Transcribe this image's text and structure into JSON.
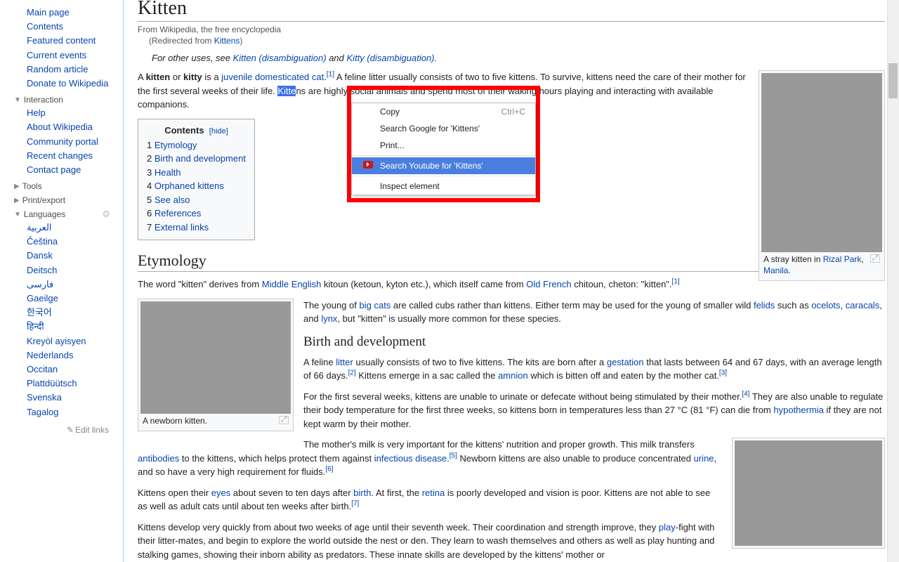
{
  "sidebar": {
    "main_nav": [
      "Main page",
      "Contents",
      "Featured content",
      "Current events",
      "Random article",
      "Donate to Wikipedia"
    ],
    "interaction_head": "Interaction",
    "interaction_items": [
      "Help",
      "About Wikipedia",
      "Community portal",
      "Recent changes",
      "Contact page"
    ],
    "tools_head": "Tools",
    "print_head": "Print/export",
    "languages_head": "Languages",
    "languages": [
      "العربية",
      "Čeština",
      "Dansk",
      "Deitsch",
      "فارسی",
      "Gaeilge",
      "한국어",
      "हिन्दी",
      "Kreyòl ayisyen",
      "Nederlands",
      "Occitan",
      "Plattdüütsch",
      "Svenska",
      "Tagalog"
    ],
    "edit_links": "Edit links"
  },
  "article": {
    "title": "Kitten",
    "from": "From Wikipedia, the free encyclopedia",
    "redir_prefix": "(Redirected from ",
    "redir_link": "Kittens",
    "redir_suffix": ")",
    "hatnote_pre": "For other uses, see ",
    "hatnote_l1": "Kitten (disambiguation)",
    "hatnote_mid": " and ",
    "hatnote_l2": "Kitty (disambiguation)",
    "intro_p": {
      "t1": "A ",
      "b1": "kitten",
      "t2": " or ",
      "b2": "kitty",
      "t3": " is a ",
      "l1": "juvenile",
      "l2": "domesticated cat",
      "ref1": "[1]",
      "t4": " A feline litter usually consists of two to five kittens. To survive, kittens need the care of their mother for the first several weeks of their life. ",
      "hl": "Kitte",
      "t5": "ns are highly social animals and spend most of their waking hours playing and interacting with available companions."
    },
    "toc_title": "Contents",
    "toc_hide": "[hide]",
    "toc": [
      {
        "n": "1",
        "t": "Etymology"
      },
      {
        "n": "2",
        "t": "Birth and development"
      },
      {
        "n": "3",
        "t": "Health"
      },
      {
        "n": "4",
        "t": "Orphaned kittens"
      },
      {
        "n": "5",
        "t": "See also"
      },
      {
        "n": "6",
        "t": "References"
      },
      {
        "n": "7",
        "t": "External links"
      }
    ],
    "thumb1_cap_pre": "A stray kitten in ",
    "thumb1_cap_l1": "Rizal Park",
    "thumb1_cap_mid": ", ",
    "thumb1_cap_l2": "Manila",
    "thumb1_cap_end": ".",
    "h2_etym": "Etymology",
    "etym_p_1": "The word \"kitten\" derives from ",
    "etym_l1": "Middle English",
    "etym_p_2": " kitoun (ketoun, kyton etc.), which itself came from ",
    "etym_l2": "Old French",
    "etym_p_3": " chitoun, cheton: \"kitten\".",
    "etym_ref": "[1]",
    "thumb2_cap": "A newborn kitten.",
    "bigcats_1": "The young of ",
    "bigcats_l1": "big cats",
    "bigcats_2": " are called cubs rather than kittens. Either term may be used for the young of smaller wild ",
    "bigcats_l2": "felids",
    "bigcats_3": " such as ",
    "bigcats_l3": "ocelots",
    "bigcats_c1": ", ",
    "bigcats_l4": "caracals",
    "bigcats_4": ", and ",
    "bigcats_l5": "lynx",
    "bigcats_5": ", but \"kitten\" is usually more common for these species.",
    "h3_birth": "Birth and development",
    "birth_p1_a": "A feline ",
    "birth_l_litter": "litter",
    "birth_p1_b": " usually consists of two to five kittens. The kits are born after a ",
    "birth_l_gest": "gestation",
    "birth_p1_c": " that lasts between 64 and 67 days, with an average length of 66 days.",
    "birth_ref2": "[2]",
    "birth_p1_d": " Kittens emerge in a sac called the ",
    "birth_l_amn": "amnion",
    "birth_p1_e": " which is bitten off and eaten by the mother cat.",
    "birth_ref3": "[3]",
    "birth_p2_a": "For the first several weeks, kittens are unable to urinate or defecate without being stimulated by their mother.",
    "birth_ref4": "[4]",
    "birth_p2_b": " They are also unable to regulate their body temperature for the first three weeks, so kittens born in temperatures less than 27 °C (81 °F) can die from ",
    "birth_l_hypo": "hypothermia",
    "birth_p2_c": " if they are not kept warm by their mother.",
    "birth_p3_a": "The mother's milk is very important for the kittens' nutrition and proper growth. This milk transfers ",
    "birth_l_anti": "antibodies",
    "birth_p3_b": " to the kittens, which helps protect them against ",
    "birth_l_inf": "infectious disease",
    "birth_p3_c": ".",
    "birth_ref5": "[5]",
    "birth_p3_d": " Newborn kittens are also unable to produce concentrated ",
    "birth_l_urine": "urine",
    "birth_p3_e": ", and so have a very high requirement for fluids.",
    "birth_ref6": "[6]",
    "birth_p4_a": "Kittens open their ",
    "birth_l_eyes": "eyes",
    "birth_p4_b": " about seven to ten days after ",
    "birth_l_birth": "birth",
    "birth_p4_c": ". At first, the ",
    "birth_l_ret": "retina",
    "birth_p4_d": " is poorly developed and vision is poor. Kittens are not able to see as well as adult cats until about ten weeks after birth.",
    "birth_ref7": "[7]",
    "birth_p5_a": "Kittens develop very quickly from about two weeks of age until their seventh week. Their coordination and strength improve, they ",
    "birth_l_play": "play",
    "birth_p5_b": "-fight with their litter-mates, and begin to explore the world outside the nest or den. They learn to wash themselves and others as well as play hunting and stalking games, showing their inborn ability as predators. These innate skills are developed by the kittens' mother or"
  },
  "context_menu": {
    "copy": "Copy",
    "copy_sc": "Ctrl+C",
    "search_google": "Search Google for 'Kittens'",
    "print": "Print...",
    "search_youtube": "Search Youtube for 'Kittens'",
    "inspect": "Inspect element"
  }
}
